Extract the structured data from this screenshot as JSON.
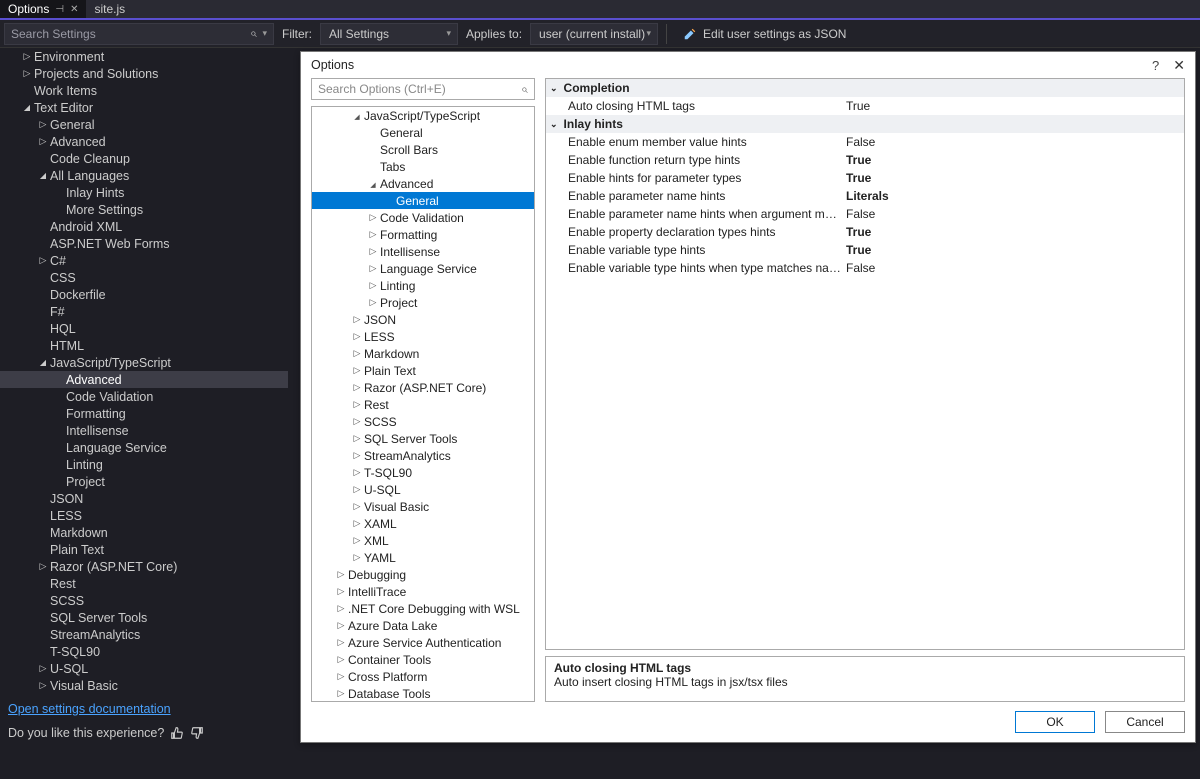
{
  "tabs": {
    "options": "Options",
    "site": "site.js"
  },
  "filterbar": {
    "search_placeholder": "Search Settings",
    "filter_label": "Filter:",
    "filter_value": "All Settings",
    "applies_label": "Applies to:",
    "applies_value": "user (current install)",
    "edit_json": "Edit user settings as JSON"
  },
  "left_tree": [
    {
      "ind": 1,
      "tw": "closed",
      "label": "Environment"
    },
    {
      "ind": 1,
      "tw": "closed",
      "label": "Projects and Solutions"
    },
    {
      "ind": 1,
      "tw": "leaf",
      "label": "Work Items"
    },
    {
      "ind": 1,
      "tw": "open",
      "label": "Text Editor"
    },
    {
      "ind": 2,
      "tw": "closed",
      "label": "General"
    },
    {
      "ind": 2,
      "tw": "closed",
      "label": "Advanced"
    },
    {
      "ind": 2,
      "tw": "leaf",
      "label": "Code Cleanup"
    },
    {
      "ind": 2,
      "tw": "open",
      "label": "All Languages"
    },
    {
      "ind": 3,
      "tw": "leaf",
      "label": "Inlay Hints"
    },
    {
      "ind": 3,
      "tw": "leaf",
      "label": "More Settings"
    },
    {
      "ind": 2,
      "tw": "leaf",
      "label": "Android XML"
    },
    {
      "ind": 2,
      "tw": "leaf",
      "label": "ASP.NET Web Forms"
    },
    {
      "ind": 2,
      "tw": "closed",
      "label": "C#"
    },
    {
      "ind": 2,
      "tw": "leaf",
      "label": "CSS"
    },
    {
      "ind": 2,
      "tw": "leaf",
      "label": "Dockerfile"
    },
    {
      "ind": 2,
      "tw": "leaf",
      "label": "F#"
    },
    {
      "ind": 2,
      "tw": "leaf",
      "label": "HQL"
    },
    {
      "ind": 2,
      "tw": "leaf",
      "label": "HTML"
    },
    {
      "ind": 2,
      "tw": "open",
      "label": "JavaScript/TypeScript"
    },
    {
      "ind": 3,
      "tw": "leaf",
      "label": "Advanced",
      "selected": true
    },
    {
      "ind": 3,
      "tw": "leaf",
      "label": "Code Validation"
    },
    {
      "ind": 3,
      "tw": "leaf",
      "label": "Formatting"
    },
    {
      "ind": 3,
      "tw": "leaf",
      "label": "Intellisense"
    },
    {
      "ind": 3,
      "tw": "leaf",
      "label": "Language Service"
    },
    {
      "ind": 3,
      "tw": "leaf",
      "label": "Linting"
    },
    {
      "ind": 3,
      "tw": "leaf",
      "label": "Project"
    },
    {
      "ind": 2,
      "tw": "leaf",
      "label": "JSON"
    },
    {
      "ind": 2,
      "tw": "leaf",
      "label": "LESS"
    },
    {
      "ind": 2,
      "tw": "leaf",
      "label": "Markdown"
    },
    {
      "ind": 2,
      "tw": "leaf",
      "label": "Plain Text"
    },
    {
      "ind": 2,
      "tw": "closed",
      "label": "Razor (ASP.NET Core)"
    },
    {
      "ind": 2,
      "tw": "leaf",
      "label": "Rest"
    },
    {
      "ind": 2,
      "tw": "leaf",
      "label": "SCSS"
    },
    {
      "ind": 2,
      "tw": "leaf",
      "label": "SQL Server Tools"
    },
    {
      "ind": 2,
      "tw": "leaf",
      "label": "StreamAnalytics"
    },
    {
      "ind": 2,
      "tw": "leaf",
      "label": "T-SQL90"
    },
    {
      "ind": 2,
      "tw": "closed",
      "label": "U-SQL"
    },
    {
      "ind": 2,
      "tw": "closed",
      "label": "Visual Basic"
    }
  ],
  "footer": {
    "doc_link": "Open settings documentation",
    "feedback": "Do you like this experience?"
  },
  "dialog": {
    "title": "Options",
    "search_placeholder": "Search Options (Ctrl+E)",
    "tree": [
      {
        "ind": 1,
        "tw": "open",
        "label": "JavaScript/TypeScript"
      },
      {
        "ind": 2,
        "tw": "leaf",
        "label": "General"
      },
      {
        "ind": 2,
        "tw": "leaf",
        "label": "Scroll Bars"
      },
      {
        "ind": 2,
        "tw": "leaf",
        "label": "Tabs"
      },
      {
        "ind": 2,
        "tw": "open",
        "label": "Advanced"
      },
      {
        "ind": 3,
        "tw": "leaf",
        "label": "General",
        "selected": true
      },
      {
        "ind": 2,
        "tw": "closed",
        "label": "Code Validation"
      },
      {
        "ind": 2,
        "tw": "closed",
        "label": "Formatting"
      },
      {
        "ind": 2,
        "tw": "closed",
        "label": "Intellisense"
      },
      {
        "ind": 2,
        "tw": "closed",
        "label": "Language Service"
      },
      {
        "ind": 2,
        "tw": "closed",
        "label": "Linting"
      },
      {
        "ind": 2,
        "tw": "closed",
        "label": "Project"
      },
      {
        "ind": 1,
        "tw": "closed",
        "label": "JSON"
      },
      {
        "ind": 1,
        "tw": "closed",
        "label": "LESS"
      },
      {
        "ind": 1,
        "tw": "closed",
        "label": "Markdown"
      },
      {
        "ind": 1,
        "tw": "closed",
        "label": "Plain Text"
      },
      {
        "ind": 1,
        "tw": "closed",
        "label": "Razor (ASP.NET Core)"
      },
      {
        "ind": 1,
        "tw": "closed",
        "label": "Rest"
      },
      {
        "ind": 1,
        "tw": "closed",
        "label": "SCSS"
      },
      {
        "ind": 1,
        "tw": "closed",
        "label": "SQL Server Tools"
      },
      {
        "ind": 1,
        "tw": "closed",
        "label": "StreamAnalytics"
      },
      {
        "ind": 1,
        "tw": "closed",
        "label": "T-SQL90"
      },
      {
        "ind": 1,
        "tw": "closed",
        "label": "U-SQL"
      },
      {
        "ind": 1,
        "tw": "closed",
        "label": "Visual Basic"
      },
      {
        "ind": 1,
        "tw": "closed",
        "label": "XAML"
      },
      {
        "ind": 1,
        "tw": "closed",
        "label": "XML"
      },
      {
        "ind": 1,
        "tw": "closed",
        "label": "YAML"
      },
      {
        "ind": 0,
        "tw": "closed",
        "label": "Debugging"
      },
      {
        "ind": 0,
        "tw": "closed",
        "label": "IntelliTrace"
      },
      {
        "ind": 0,
        "tw": "closed",
        "label": ".NET Core Debugging with WSL"
      },
      {
        "ind": 0,
        "tw": "closed",
        "label": "Azure Data Lake"
      },
      {
        "ind": 0,
        "tw": "closed",
        "label": "Azure Service Authentication"
      },
      {
        "ind": 0,
        "tw": "closed",
        "label": "Container Tools"
      },
      {
        "ind": 0,
        "tw": "closed",
        "label": "Cross Platform"
      },
      {
        "ind": 0,
        "tw": "closed",
        "label": "Database Tools"
      }
    ],
    "categories": [
      {
        "name": "Completion",
        "rows": [
          {
            "k": "Auto closing HTML tags",
            "v": "True",
            "bold": false
          }
        ]
      },
      {
        "name": "Inlay hints",
        "rows": [
          {
            "k": "Enable enum member value hints",
            "v": "False",
            "bold": false
          },
          {
            "k": "Enable function return type hints",
            "v": "True",
            "bold": true
          },
          {
            "k": "Enable hints for parameter types",
            "v": "True",
            "bold": true
          },
          {
            "k": "Enable parameter name hints",
            "v": "Literals",
            "bold": true
          },
          {
            "k": "Enable parameter name hints when argument matches name",
            "v": "False",
            "bold": false
          },
          {
            "k": "Enable property declaration types hints",
            "v": "True",
            "bold": true
          },
          {
            "k": "Enable variable type hints",
            "v": "True",
            "bold": true
          },
          {
            "k": "Enable variable type hints when type matches name",
            "v": "False",
            "bold": false
          }
        ]
      }
    ],
    "desc_title": "Auto closing HTML tags",
    "desc_body": "Auto insert closing HTML tags in jsx/tsx files",
    "ok": "OK",
    "cancel": "Cancel"
  }
}
